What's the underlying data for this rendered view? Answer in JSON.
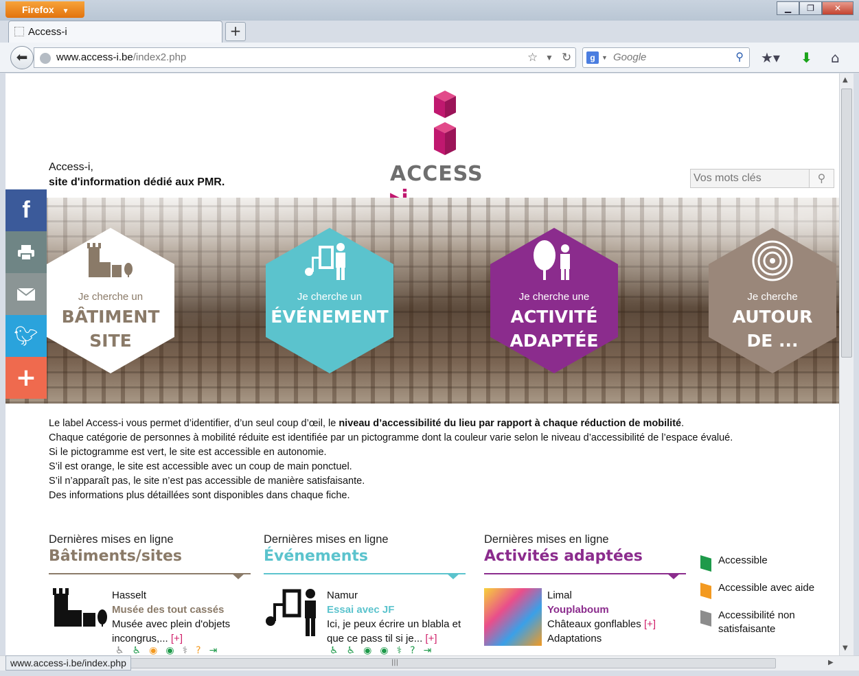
{
  "browser": {
    "app_button": "Firefox",
    "tab_title": "Access-i",
    "url_domain": "www.access-i.be",
    "url_path": "/index2.php",
    "search_engine_placeholder": "Google",
    "status_url": "www.access-i.be/index.php"
  },
  "header": {
    "tagline_line1": "Access-i,",
    "tagline_line2": "site d'information dédié aux PMR.",
    "logo_text": "ACCESS",
    "logo_i": "i",
    "search_placeholder": "Vos mots clés"
  },
  "social": [
    "facebook-icon",
    "print-icon",
    "mail-icon",
    "twitter-icon",
    "plus-icon"
  ],
  "hexes": [
    {
      "small": "Je cherche un",
      "big1": "BÂTIMENT",
      "big2": "SITE",
      "bg": "#ffffff",
      "fg": "#8a7a68",
      "fg2": "#5b5b5b"
    },
    {
      "small": "Je cherche un",
      "big1": "ÉVÉNEMENT",
      "big2": "",
      "bg": "#5bc3cd",
      "fg": "#ffffff",
      "fg2": "#ffffff"
    },
    {
      "small": "Je cherche une",
      "big1": "ACTIVITÉ",
      "big2": "ADAPTÉE",
      "bg": "#8b2c8d",
      "fg": "#ffffff",
      "fg2": "#ffffff"
    },
    {
      "small": "Je cherche",
      "big1": "AUTOUR",
      "big2": "DE ...",
      "bg": "#9a877a",
      "fg": "#ffffff",
      "fg2": "#ffffff"
    }
  ],
  "intro": {
    "l1a": "Le label Access-i vous permet d’identifier, d’un seul coup d’œil, le ",
    "l1b": "niveau d’accessibilité du lieu par rapport à chaque réduction de mobilité",
    "l1c": ".",
    "l2": "Chaque catégorie de personnes à mobilité réduite est identifiée par un pictogramme dont la couleur varie selon le niveau d’accessibilité de l’espace évalué.",
    "l3": "Si le pictogramme est vert, le site est accessible en autonomie.",
    "l4": "S’il est orange, le site est accessible avec un coup de main ponctuel.",
    "l5": "S’il n’apparaît pas, le site n’est pas accessible de manière satisfaisante.",
    "l6": "Des informations plus détaillées sont disponibles dans chaque fiche."
  },
  "columns": [
    {
      "pre": "Dernières mises en ligne",
      "title": "Bâtiments/sites",
      "color": "#8a7a68",
      "city": "Hasselt",
      "name": "Musée des tout cassés",
      "desc1": "Musée avec plein d'objets",
      "desc2": "incongrus,...",
      "more": "[+]"
    },
    {
      "pre": "Dernières mises en ligne",
      "title": "Événements",
      "color": "#5bc3cd",
      "city": "Namur",
      "name": "Essai avec JF",
      "desc1": "Ici, je peux écrire un blabla et",
      "desc2": "que ce pass til si je...",
      "more": "[+]"
    },
    {
      "pre": "Dernières mises en ligne",
      "title": "Activités adaptées",
      "color": "#8b2c8d",
      "city": "Limal",
      "name": "Youplaboum",
      "desc1": "Châteaux gonflables",
      "desc2": "Adaptations",
      "more": "[+]"
    }
  ],
  "legend": [
    {
      "label": "Accessible",
      "color": "#1e9a4a"
    },
    {
      "label": "Accessible avec aide",
      "color": "#f39a21"
    },
    {
      "label": "Accessibilité non",
      "label2": "satisfaisante",
      "color": "#8c8c8c"
    }
  ]
}
